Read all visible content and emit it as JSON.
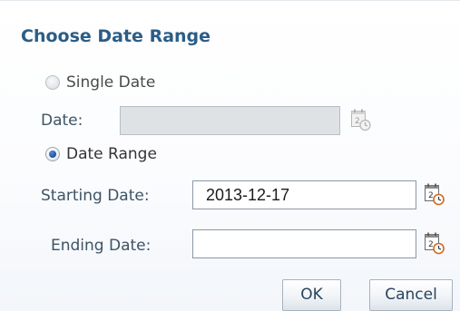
{
  "dialog": {
    "title": "Choose Date Range"
  },
  "single_date": {
    "option_label": "Single Date",
    "selected": false,
    "date_label": "Date:",
    "date_value": "",
    "enabled": false
  },
  "date_range": {
    "option_label": "Date Range",
    "selected": true,
    "start_label": "Starting Date:",
    "start_value": "2013-12-17",
    "end_label": "Ending Date:",
    "end_value": ""
  },
  "buttons": {
    "ok": "OK",
    "cancel": "Cancel"
  },
  "icons": {
    "date_picker": "calendar-clock-icon"
  },
  "colors": {
    "title": "#2b5d86",
    "radio_selected": "#2157a8",
    "clock_accent": "#d2691e"
  }
}
